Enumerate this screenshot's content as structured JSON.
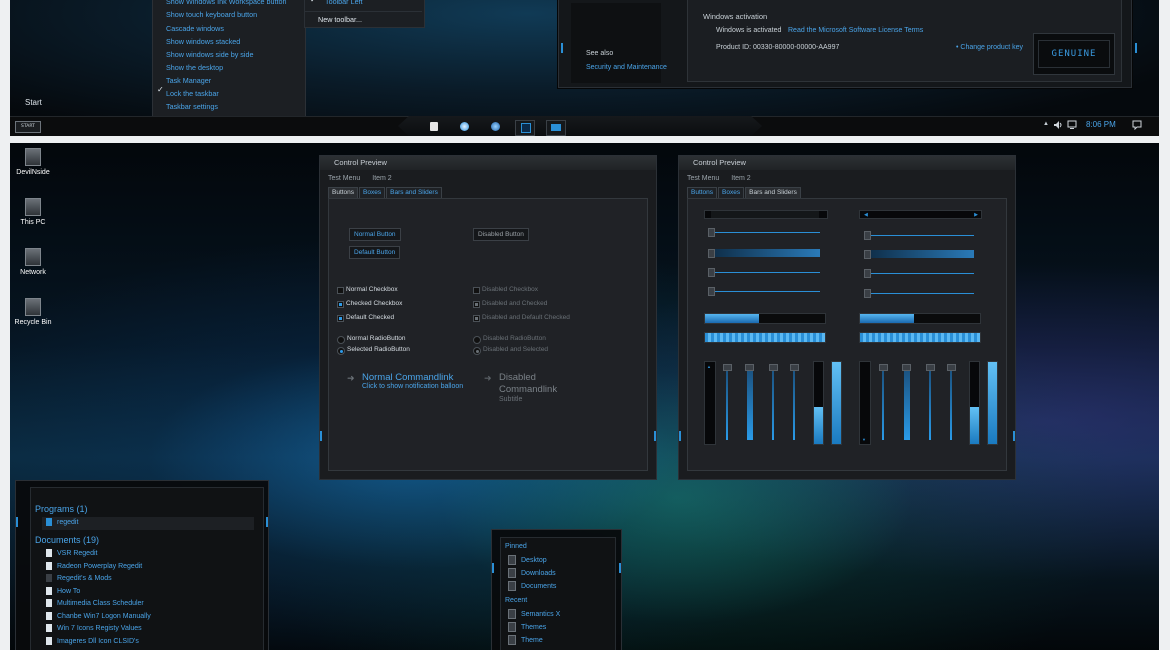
{
  "context_menu": {
    "items": [
      {
        "label": "Show Windows Ink Workspace button",
        "checked": false
      },
      {
        "label": "Show touch keyboard button",
        "checked": false
      },
      {
        "label": "Cascade windows",
        "checked": false
      },
      {
        "label": "Show windows stacked",
        "checked": false
      },
      {
        "label": "Show windows side by side",
        "checked": false
      },
      {
        "label": "Show the desktop",
        "checked": false
      },
      {
        "label": "Task Manager",
        "checked": false
      },
      {
        "label": "Lock the taskbar",
        "checked": true
      },
      {
        "label": "Taskbar settings",
        "checked": false
      }
    ],
    "check_glyph": "✓"
  },
  "toolbar_menu": {
    "items": [
      {
        "label": "Toolbar Left",
        "checked": true
      },
      {
        "label": "New toolbar...",
        "checked": false
      }
    ]
  },
  "start_label": "Start",
  "start_button": "START",
  "system_window": {
    "see_also": "See also",
    "security_link": "Security and Maintenance",
    "activation_heading": "Windows activation",
    "activation_status": "Windows is activated",
    "license_link": "Read the Microsoft Software License Terms",
    "product_id": "Product ID: 00330-80000-00000-AA997",
    "change_key": "Change product key",
    "genuine_badge": "GENUINE"
  },
  "tray": {
    "arrow": "▲",
    "time": "8:06 PM"
  },
  "desktop_icons": [
    {
      "label": "DevilNside"
    },
    {
      "label": "This PC"
    },
    {
      "label": "Network"
    },
    {
      "label": "Recycle Bin"
    }
  ],
  "control_preview_left": {
    "title": "Control Preview",
    "menu": [
      "Test Menu",
      "Item 2"
    ],
    "tabs": [
      "Buttons",
      "Boxes",
      "Bars and Sliders"
    ],
    "active_tab": 0,
    "buttons": {
      "normal": "Normal Button",
      "default": "Default Button",
      "disabled": "Disabled Button"
    },
    "checkboxes": {
      "normal": "Normal Checkbox",
      "checked": "Checked Checkbox",
      "default_checked": "Default Checked",
      "disabled": "Disabled Checkbox",
      "disabled_checked": "Disabled and Checked",
      "disabled_default_checked": "Disabled and Default Checked"
    },
    "radios": {
      "normal": "Normal RadioButton",
      "selected": "Selected RadioButton",
      "disabled": "Disabled RadioButton",
      "disabled_selected": "Disabled and Selected"
    },
    "commandlinks": {
      "normal_title": "Normal Commandlink",
      "normal_sub": "Click to show notification balloon",
      "disabled_title": "Disabled Commandlink",
      "disabled_sub": "Subtitle"
    }
  },
  "control_preview_right": {
    "title": "Control Preview",
    "menu": [
      "Test Menu",
      "Item 2"
    ],
    "tabs": [
      "Buttons",
      "Boxes",
      "Bars and Sliders"
    ],
    "active_tab": 2,
    "progress_left": [
      0.45,
      1.0
    ],
    "progress_right": [
      0.45,
      1.0
    ],
    "vertical_left": [
      0.45,
      1.0
    ],
    "vertical_right": [
      0.45,
      1.0
    ]
  },
  "search_menu": {
    "programs_heading": "Programs (1)",
    "programs": [
      "regedit"
    ],
    "documents_heading": "Documents (19)",
    "documents": [
      "VSR Regedit",
      "Radeon Powerplay Regedit",
      "Regedit's & Mods",
      "How To",
      "Multimedia Class Scheduler",
      "Chanbe Win7 Logon Manually",
      "Win 7 Icons Registy Values",
      "Imageres Dll Icon CLSID's"
    ]
  },
  "jump_list": {
    "pinned_heading": "Pinned",
    "pinned": [
      "Desktop",
      "Downloads",
      "Documents"
    ],
    "recent_heading": "Recent",
    "recent": [
      "Semantics X",
      "Themes",
      "Theme"
    ]
  },
  "colors": {
    "accent": "#2f9be8",
    "panel_dark": "#1a1c1f",
    "text_light": "#d6dde3"
  }
}
